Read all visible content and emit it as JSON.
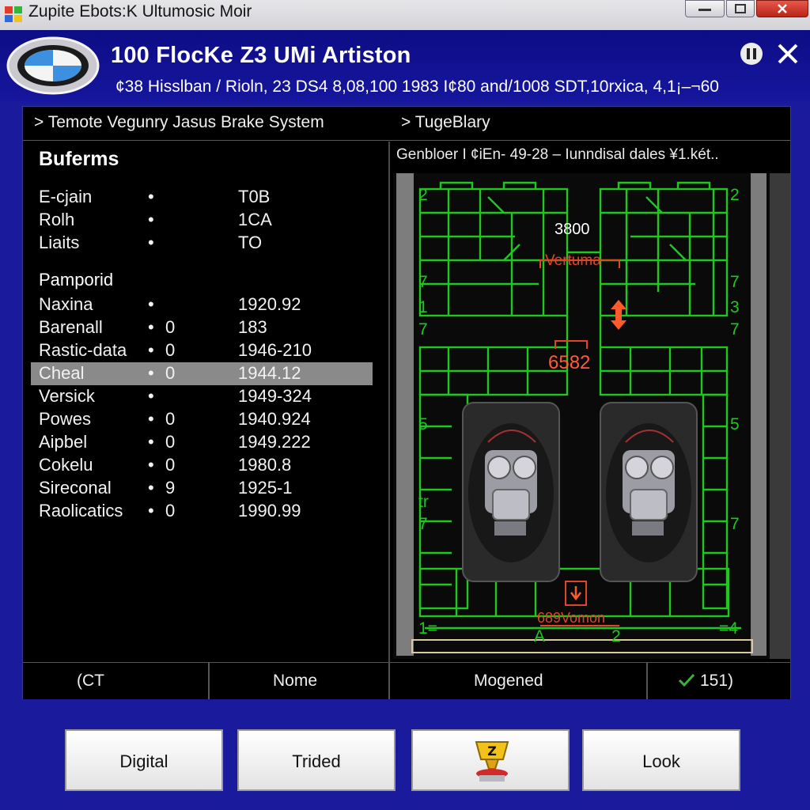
{
  "window": {
    "title": "Zupite Ebots:K Ultumosic Moir"
  },
  "header": {
    "title": "100 FlocKe Z3 UMi Artiston",
    "subtitle": "¢38 Hisslban / Rioln, 23 DS4 8,08,100 1983 I¢80 and/1008 SDT,10rxica, 4,1¡–¬60"
  },
  "tabs": {
    "left": "> Temote Vegunry Jasus Brake System",
    "right": "> TugeBlary"
  },
  "panel": {
    "section_title": "Buferms",
    "section2_title": "Pamporid",
    "top_rows": [
      {
        "label": "E-cjain",
        "flag": "",
        "value": "T0B"
      },
      {
        "label": "Rolh",
        "flag": "",
        "value": "1CA"
      },
      {
        "label": "Liaits",
        "flag": "",
        "value": "TO"
      }
    ],
    "rows": [
      {
        "label": "Naxina",
        "flag": "",
        "value": "1920.92"
      },
      {
        "label": "Barenall",
        "flag": "0",
        "value": "183"
      },
      {
        "label": "Rastic-data",
        "flag": "0",
        "value": "1946-210"
      },
      {
        "label": "Cheal",
        "flag": "0",
        "value": "1944.12"
      },
      {
        "label": "Versick",
        "flag": "",
        "value": "1949-324"
      },
      {
        "label": "Powes",
        "flag": "0",
        "value": "1940.924"
      },
      {
        "label": "Aipbel",
        "flag": "0",
        "value": "1949.222"
      },
      {
        "label": "Cokelu",
        "flag": "0",
        "value": "1980.8"
      },
      {
        "label": "Sireconal",
        "flag": "9",
        "value": "1925-1"
      },
      {
        "label": "Raolicatics",
        "flag": "0",
        "value": "1990.99"
      }
    ],
    "bullet": "•"
  },
  "viewer": {
    "caption": "Genbloer I ¢iЕn- 49-28 – Iunndisal dales ¥1.két..",
    "label_top": "3800",
    "label_red1": "Vertuma",
    "label_red2": "6582",
    "label_bottom": "689Vomon",
    "side_numbers_left": [
      "2",
      "7",
      "1",
      "7",
      "5",
      "tr",
      "7",
      "1="
    ],
    "side_numbers_right": [
      "2",
      "7",
      "3",
      "7",
      "5",
      "7",
      "=4"
    ],
    "bottom_small": [
      "A",
      "2"
    ],
    "colors": {
      "wire": "#1fc81f",
      "accent": "#e0452a"
    }
  },
  "status": {
    "cells": [
      "(CT",
      "Nome",
      "Mogened",
      "151)"
    ]
  },
  "buttons": {
    "digital": "Digital",
    "trided": "Trided",
    "icon_button_badge": "Z",
    "look": "Look"
  }
}
